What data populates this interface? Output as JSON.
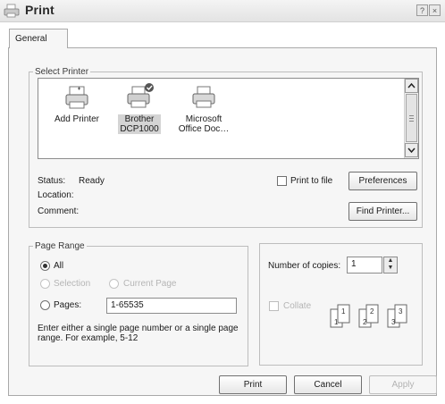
{
  "window": {
    "title": "Print",
    "help_label": "?",
    "close_label": "×"
  },
  "tabs": [
    {
      "label": "General",
      "selected": true
    }
  ],
  "select_printer": {
    "legend": "Select Printer",
    "printers": [
      {
        "line1": "Add Printer",
        "line2": "",
        "icon": "add-printer-icon",
        "selected": false
      },
      {
        "line1": "Brother",
        "line2": "DCP1000",
        "icon": "default-printer-icon",
        "selected": true
      },
      {
        "line1": "Microsoft",
        "line2": "Office Doc…",
        "icon": "printer-icon",
        "selected": false
      }
    ],
    "status_label": "Status:",
    "status_value": "Ready",
    "location_label": "Location:",
    "location_value": "",
    "comment_label": "Comment:",
    "comment_value": "",
    "print_to_file_label": "Print to file",
    "print_to_file_checked": false,
    "preferences_label": "Preferences",
    "find_printer_label": "Find Printer..."
  },
  "page_range": {
    "legend": "Page Range",
    "all_label": "All",
    "all_selected": true,
    "selection_label": "Selection",
    "current_page_label": "Current Page",
    "pages_label": "Pages:",
    "pages_value": "1-65535",
    "hint": "Enter either a single page number or a single page range.  For example, 5-12"
  },
  "copies": {
    "number_label": "Number of copies:",
    "value": "1",
    "collate_label": "Collate",
    "collate_checked": false,
    "collate_pages": [
      "1",
      "1",
      "2",
      "2",
      "3",
      "3"
    ]
  },
  "footer": {
    "print_label": "Print",
    "cancel_label": "Cancel",
    "apply_label": "Apply"
  },
  "colors": {
    "window_bg": "#ffffff",
    "panel_bg": "#f6f6f6",
    "border": "#a9a9a9",
    "disabled_text": "#b5b5b5"
  }
}
